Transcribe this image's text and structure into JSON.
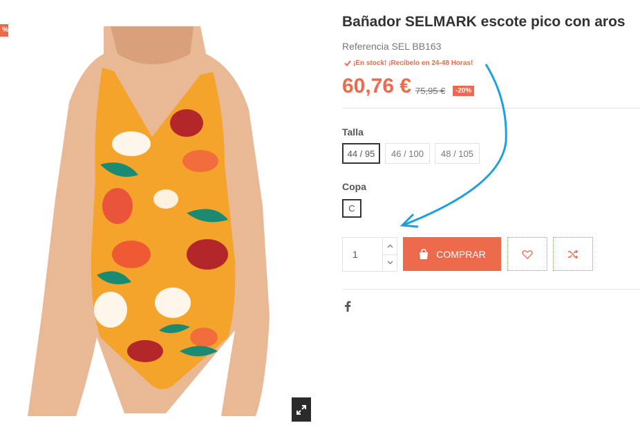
{
  "product": {
    "discount_corner_label": "%",
    "title": "Bañador SELMARK escote pico con aros",
    "reference": "Referencia SEL BB163",
    "stock": "¡En stock! ¡Recíbelo en 24-48 Horas!",
    "price": "60,76 €",
    "old_price": "75,95 €",
    "discount_badge": "-20%"
  },
  "options": {
    "size_label": "Talla",
    "sizes": [
      "44 / 95",
      "46 / 100",
      "48 / 105"
    ],
    "selected_size": "44 / 95",
    "cup_label": "Copa",
    "cups": [
      "C"
    ]
  },
  "cart": {
    "quantity": "1",
    "buy_label": "COMPRAR"
  },
  "icons": {
    "stock": "check-icon",
    "zoom": "expand-icon",
    "buy": "shopping-bag-icon",
    "wishlist": "heart-icon",
    "compare": "shuffle-icon",
    "share": "facebook-icon",
    "qty_up": "chevron-up-icon",
    "qty_down": "chevron-down-icon"
  },
  "colors": {
    "accent": "#ee6a4d",
    "annotation_arrow": "#1a9fe0"
  }
}
